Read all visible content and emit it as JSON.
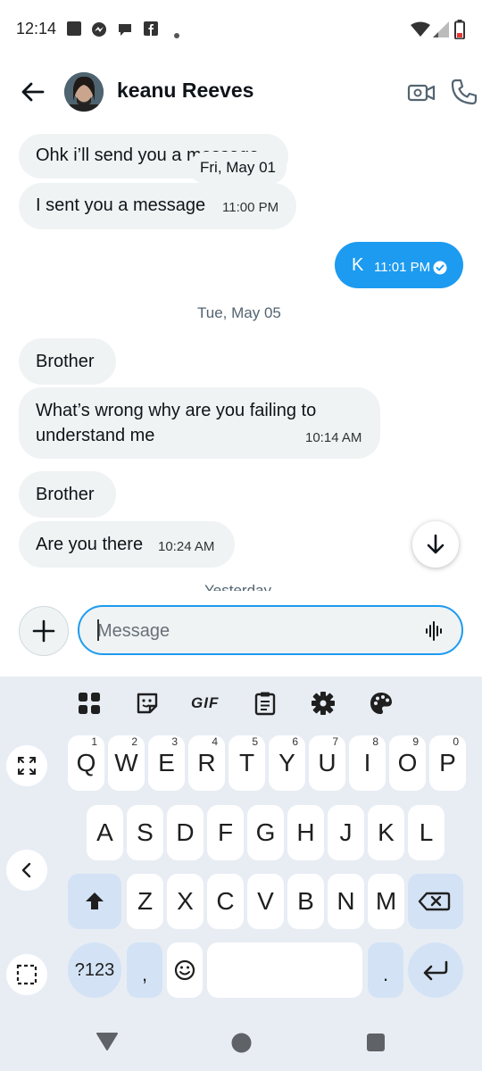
{
  "status_bar": {
    "time": "12:14",
    "icons": [
      "gallery-icon",
      "messenger-icon",
      "chat-icon",
      "facebook-icon",
      "dot-icon",
      "wifi-icon",
      "signal-icon",
      "battery-low-icon"
    ]
  },
  "header": {
    "contact_name": "keanu Reeves",
    "icons": [
      "back-arrow-icon",
      "video-call-icon",
      "phone-icon"
    ]
  },
  "messages": [
    {
      "direction": "in",
      "text": "Ohk i’ll send you a message",
      "time": ""
    },
    {
      "direction": "in",
      "text": "I sent you a message",
      "time": "11:00 PM"
    },
    {
      "direction": "out",
      "text": "K",
      "time": "11:01 PM",
      "status": "read-check-icon"
    },
    {
      "direction": "in",
      "text": "Brother",
      "time": ""
    },
    {
      "direction": "in",
      "text_line1": "What’s wrong why are you failing to",
      "text_line2": "understand me",
      "time": "10:14 AM"
    },
    {
      "direction": "in",
      "text": "Brother",
      "time": ""
    },
    {
      "direction": "in",
      "text": "Are you there",
      "time": "10:24 AM"
    }
  ],
  "date_separators": {
    "floating": "Fri, May 01",
    "tue": "Tue, May 05",
    "yesterday": "Yesterday"
  },
  "composer": {
    "placeholder": "Message",
    "icons": [
      "plus-icon",
      "voice-wave-icon"
    ]
  },
  "keyboard": {
    "toolbar": {
      "gif_label": "GIF",
      "icons": [
        "apps-grid-icon",
        "sticker-icon",
        "gif-icon",
        "clipboard-icon",
        "settings-icon",
        "palette-icon"
      ]
    },
    "row1": [
      {
        "key": "Q",
        "hint": "1"
      },
      {
        "key": "W",
        "hint": "2"
      },
      {
        "key": "E",
        "hint": "3"
      },
      {
        "key": "R",
        "hint": "4"
      },
      {
        "key": "T",
        "hint": "5"
      },
      {
        "key": "Y",
        "hint": "6"
      },
      {
        "key": "U",
        "hint": "7"
      },
      {
        "key": "I",
        "hint": "8"
      },
      {
        "key": "O",
        "hint": "9"
      },
      {
        "key": "P",
        "hint": "0"
      }
    ],
    "row2": [
      "A",
      "S",
      "D",
      "F",
      "G",
      "H",
      "J",
      "K",
      "L"
    ],
    "row3": [
      "Z",
      "X",
      "C",
      "V",
      "B",
      "N",
      "M"
    ],
    "symbols_label": "?123",
    "comma_label": ",",
    "period_label": ".",
    "side_icons": [
      "expand-icon",
      "collapse-left-icon",
      "select-frame-icon"
    ]
  },
  "nav_bar": {
    "icons": [
      "back-triangle-icon",
      "home-circle-icon",
      "recents-square-icon"
    ]
  },
  "colors": {
    "accent": "#1d9bf0",
    "bubble_in": "#eff3f4",
    "keyboard_bg": "#e8edf4",
    "key_fn": "#d3e3f5"
  }
}
